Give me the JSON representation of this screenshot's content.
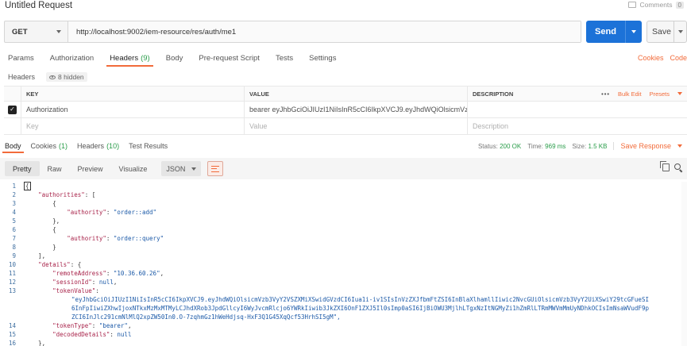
{
  "request": {
    "title": "Untitled Request",
    "comments_label": "Comments",
    "comments_count": "0",
    "method": "GET",
    "url": "http://localhost:9002/iem-resource/res/auth/me1",
    "send_label": "Send",
    "save_label": "Save"
  },
  "tabs": [
    {
      "label": "Params",
      "count": ""
    },
    {
      "label": "Authorization",
      "count": ""
    },
    {
      "label": "Headers",
      "count": "(9)"
    },
    {
      "label": "Body",
      "count": ""
    },
    {
      "label": "Pre-request Script",
      "count": ""
    },
    {
      "label": "Tests",
      "count": ""
    },
    {
      "label": "Settings",
      "count": ""
    }
  ],
  "right_links": {
    "cookies": "Cookies",
    "code": "Code"
  },
  "headers_section": {
    "label": "Headers",
    "hidden": "8 hidden"
  },
  "headers_table": {
    "columns": {
      "key": "KEY",
      "value": "VALUE",
      "description": "DESCRIPTION"
    },
    "actions": {
      "bulk_edit": "Bulk Edit",
      "presets": "Presets",
      "more": "•••"
    },
    "row": {
      "key": "Authorization",
      "value": "bearer eyJhbGciOiJIUzI1NiIsInR5cCI6IkpXVCJ9.eyJhdWQiOlsicmVzb3…"
    },
    "placeholders": {
      "key": "Key",
      "value": "Value",
      "description": "Description"
    }
  },
  "response_tabs": [
    {
      "label": "Body",
      "count": ""
    },
    {
      "label": "Cookies",
      "count": "(1)"
    },
    {
      "label": "Headers",
      "count": "(10)"
    },
    {
      "label": "Test Results",
      "count": ""
    }
  ],
  "response_meta": {
    "status_label": "Status:",
    "status_value": "200 OK",
    "time_label": "Time:",
    "time_value": "969 ms",
    "size_label": "Size:",
    "size_value": "1.5 KB",
    "save_response": "Save Response"
  },
  "view_tabs": [
    "Pretty",
    "Raw",
    "Preview",
    "Visualize"
  ],
  "format": "JSON",
  "code_lines": [
    {
      "n": "1",
      "tokens": [
        [
          "pun",
          "{"
        ]
      ]
    },
    {
      "n": "2",
      "tokens": [
        [
          "pun",
          "    "
        ],
        [
          "key",
          "\"authorities\""
        ],
        [
          "pun",
          ": ["
        ]
      ]
    },
    {
      "n": "3",
      "tokens": [
        [
          "pun",
          "        {"
        ]
      ]
    },
    {
      "n": "4",
      "tokens": [
        [
          "pun",
          "            "
        ],
        [
          "key",
          "\"authority\""
        ],
        [
          "pun",
          ": "
        ],
        [
          "str",
          "\"order::add\""
        ]
      ]
    },
    {
      "n": "5",
      "tokens": [
        [
          "pun",
          "        },"
        ]
      ]
    },
    {
      "n": "6",
      "tokens": [
        [
          "pun",
          "        {"
        ]
      ]
    },
    {
      "n": "7",
      "tokens": [
        [
          "pun",
          "            "
        ],
        [
          "key",
          "\"authority\""
        ],
        [
          "pun",
          ": "
        ],
        [
          "str",
          "\"order::query\""
        ]
      ]
    },
    {
      "n": "8",
      "tokens": [
        [
          "pun",
          "        }"
        ]
      ]
    },
    {
      "n": "9",
      "tokens": [
        [
          "pun",
          "    ],"
        ]
      ]
    },
    {
      "n": "10",
      "tokens": [
        [
          "pun",
          "    "
        ],
        [
          "key",
          "\"details\""
        ],
        [
          "pun",
          ": {"
        ]
      ]
    },
    {
      "n": "11",
      "tokens": [
        [
          "pun",
          "        "
        ],
        [
          "key",
          "\"remoteAddress\""
        ],
        [
          "pun",
          ": "
        ],
        [
          "str",
          "\"10.36.60.26\""
        ],
        [
          "pun",
          ","
        ]
      ]
    },
    {
      "n": "12",
      "tokens": [
        [
          "pun",
          "        "
        ],
        [
          "key",
          "\"sessionId\""
        ],
        [
          "pun",
          ": "
        ],
        [
          "lit",
          "null"
        ],
        [
          "pun",
          ","
        ]
      ]
    },
    {
      "n": "13",
      "tokens": [
        [
          "pun",
          "        "
        ],
        [
          "key",
          "\"tokenValue\""
        ],
        [
          "pun",
          ":"
        ]
      ]
    },
    {
      "n": "",
      "wrap": "\"eyJhbGciOiJIUzI1NiIsInR5cCI6IkpXVCJ9.eyJhdWQiOlsicmVzb3VyY2VSZXMiXSwidGVzdCI6Iua1i-iv1SIsInVzZXJfbmFtZSI6InBlaXlhamllIiwic2NvcGUiOlsicmVzb3VyY2UiXSwiY29tcGFueSI6InFpIiwiZXhwIjoxNTkxMzMxMTMyLCJhdXRob3JpdGllcyI6WyJvcmRlcjo6YWRkIiwib3JkZXI6OnF1ZXJ5Il0sImp0aSI6IjBiOWU3MjlhLTgxNzItNGMyZi1hZmRlLTRmMWVmMmUyNDhkOCIsImNsaWVudF9pZCI6InJlc291cmNlMlQ2xpZW50In0.O-7zqhmGz1hWeHdjsq-HxF3Q1G45XqQcf53HrhSI5gM\","
    },
    {
      "n": "14",
      "tokens": [
        [
          "pun",
          "        "
        ],
        [
          "key",
          "\"tokenType\""
        ],
        [
          "pun",
          ": "
        ],
        [
          "str",
          "\"bearer\""
        ],
        [
          "pun",
          ","
        ]
      ]
    },
    {
      "n": "15",
      "tokens": [
        [
          "pun",
          "        "
        ],
        [
          "key",
          "\"decodedDetails\""
        ],
        [
          "pun",
          ": "
        ],
        [
          "lit",
          "null"
        ]
      ]
    },
    {
      "n": "16",
      "tokens": [
        [
          "pun",
          "    },"
        ]
      ]
    }
  ],
  "colors": {
    "accent": "#f26b3a",
    "send": "#1c72d8",
    "ok": "#2a9d4a"
  }
}
